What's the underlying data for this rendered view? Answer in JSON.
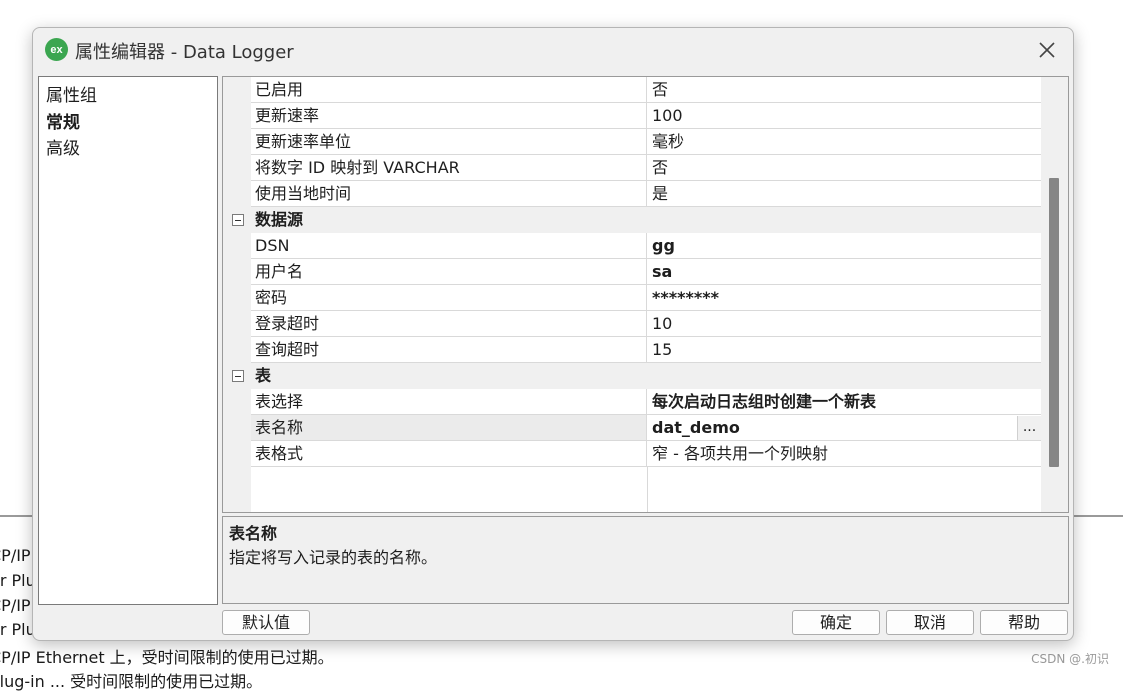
{
  "background": {
    "lines": [
      "CP/IP",
      "er Plu",
      "CP/IP",
      "er Plu",
      "CP/IP Ethernet 上，受时间限制的使用已过期。",
      "Plug-in ... 受时间限制的使用已过期。"
    ],
    "watermark": "CSDN @.初识"
  },
  "dialog": {
    "app_icon": "ex",
    "title": "属性编辑器 - Data Logger",
    "close_icon": "close-x-icon"
  },
  "categories": {
    "header": "属性组",
    "items": [
      "常规",
      "高级"
    ],
    "selected": "常规"
  },
  "grid": {
    "rows": [
      {
        "type": "prop",
        "name": "已启用",
        "value": "否",
        "bold": false
      },
      {
        "type": "prop",
        "name": "更新速率",
        "value": "100",
        "bold": false
      },
      {
        "type": "prop",
        "name": "更新速率单位",
        "value": "毫秒",
        "bold": false
      },
      {
        "type": "prop",
        "name": "将数字 ID 映射到 VARCHAR",
        "value": "否",
        "bold": false
      },
      {
        "type": "prop",
        "name": "使用当地时间",
        "value": "是",
        "bold": false
      },
      {
        "type": "category",
        "name": "数据源",
        "expanded": true
      },
      {
        "type": "prop",
        "name": "DSN",
        "value": "gg",
        "bold": true
      },
      {
        "type": "prop",
        "name": "用户名",
        "value": "sa",
        "bold": true
      },
      {
        "type": "prop",
        "name": "密码",
        "value": "********",
        "bold": true
      },
      {
        "type": "prop",
        "name": "登录超时",
        "value": "10",
        "bold": false
      },
      {
        "type": "prop",
        "name": "查询超时",
        "value": "15",
        "bold": false
      },
      {
        "type": "category",
        "name": "表",
        "expanded": true
      },
      {
        "type": "prop",
        "name": "表选择",
        "value": "每次启动日志组时创建一个新表",
        "bold": true
      },
      {
        "type": "prop",
        "name": "表名称",
        "value": "dat_demo",
        "bold": true,
        "selected": true,
        "ellipsis": "..."
      },
      {
        "type": "prop",
        "name": "表格式",
        "value": "窄 - 各项共用一个列映射",
        "bold": false
      }
    ]
  },
  "description": {
    "title": "表名称",
    "text": "指定将写入记录的表的名称。"
  },
  "buttons": {
    "defaults": "默认值",
    "ok": "确定",
    "cancel": "取消",
    "help": "帮助"
  }
}
